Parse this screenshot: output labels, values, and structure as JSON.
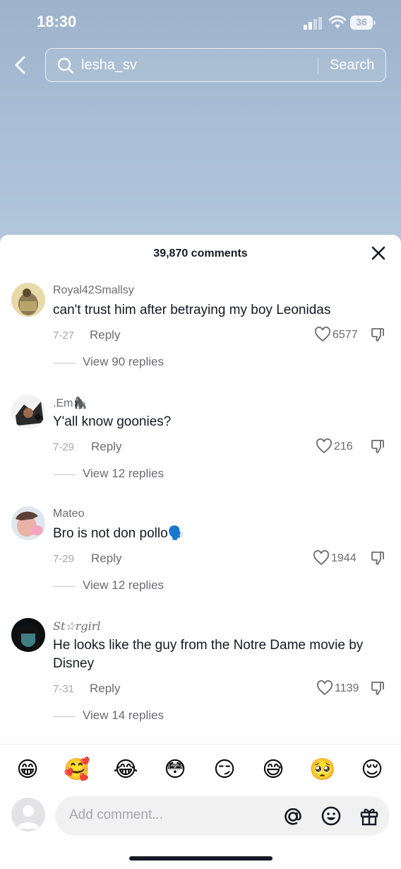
{
  "status_bar": {
    "time": "18:30",
    "battery": "36"
  },
  "search": {
    "query": "lesha_sv",
    "button_label": "Search"
  },
  "sheet": {
    "comment_count": "39,870 comments"
  },
  "comments": [
    {
      "username": "Royal42Smallsy",
      "text": "can't trust him after betraying my boy Leonidas",
      "date": "7-27",
      "reply_label": "Reply",
      "likes": "6577",
      "view_replies": "View 90 replies"
    },
    {
      "username": ".Em🦍",
      "text": "Y'all know goonies?",
      "date": "7-29",
      "reply_label": "Reply",
      "likes": "216",
      "view_replies": "View 12 replies"
    },
    {
      "username": "Mateo",
      "text": "Bro is not don pollo🗣️",
      "date": "7-29",
      "reply_label": "Reply",
      "likes": "1944",
      "view_replies": "View 12 replies"
    },
    {
      "username": "St☆rgirl",
      "text": "He looks like the guy from the Notre Dame movie by Disney",
      "date": "7-31",
      "reply_label": "Reply",
      "likes": "1139",
      "view_replies": "View 14 replies"
    }
  ],
  "quick_emojis": [
    "😁",
    "🥰",
    "😂",
    "😳",
    "😏",
    "😅",
    "🥺",
    "😌"
  ],
  "composer": {
    "placeholder": "Add comment..."
  },
  "colors": {
    "text_primary": "#161823",
    "text_secondary": "#6b6b70",
    "text_muted": "#a6a6ab",
    "sky_top": "#9db3cc"
  },
  "icons": [
    "back-arrow-icon",
    "search-icon",
    "close-icon",
    "heart-icon",
    "dislike-icon",
    "at-mention-icon",
    "emoji-icon",
    "gift-icon",
    "signal-icon",
    "wifi-icon",
    "battery-icon"
  ]
}
